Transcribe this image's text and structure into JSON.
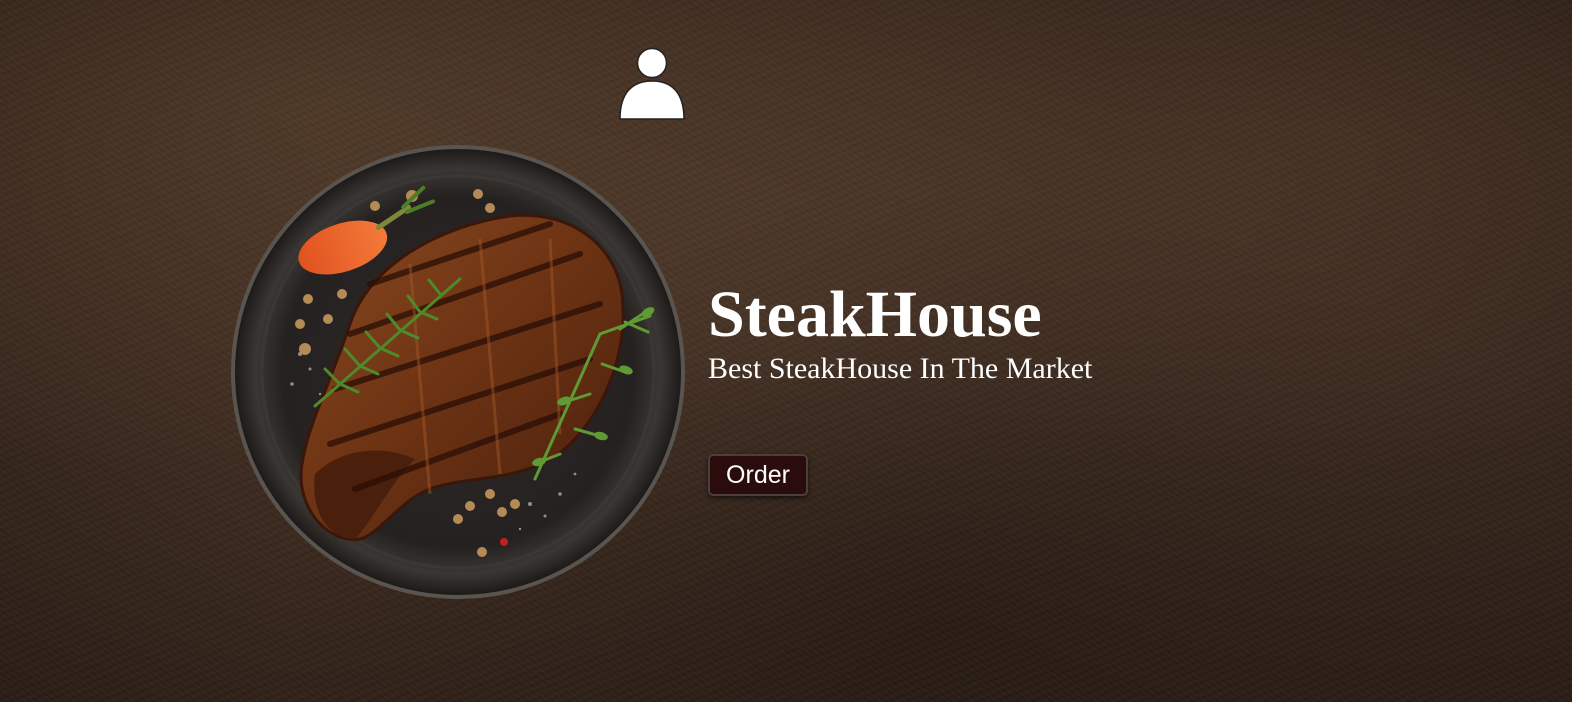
{
  "header": {
    "profile_icon": "user-icon"
  },
  "hero": {
    "image_icon": "steak-plate-image",
    "title": "SteakHouse",
    "subtitle": "Best SteakHouse In The Market",
    "order_label": "Order"
  },
  "colors": {
    "background": "#3b2a1f",
    "text": "#ffffff",
    "button_background": "#2a0c0c",
    "button_border": "#4a3f3c"
  }
}
